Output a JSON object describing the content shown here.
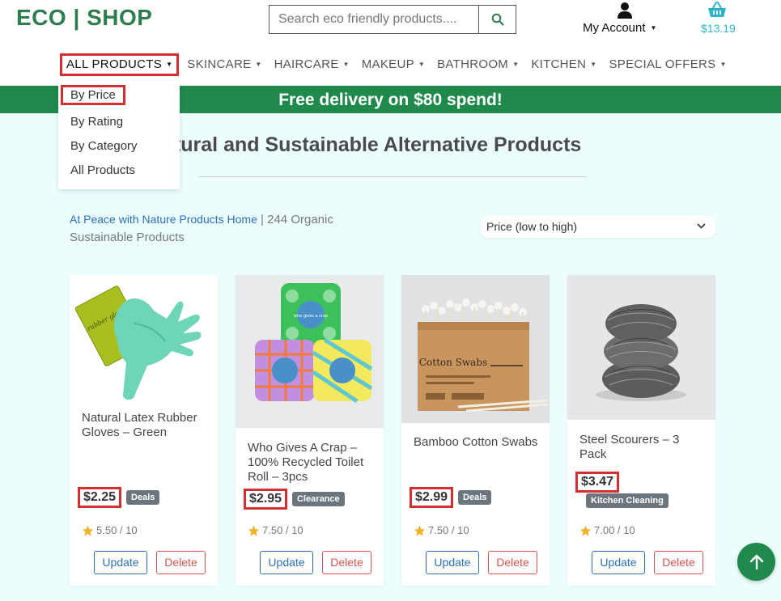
{
  "header": {
    "logo": "ECO | SHOP",
    "search_placeholder": "Search eco friendly products....",
    "account_label": "My Account",
    "cart_amount": "$13.19"
  },
  "nav": {
    "items": [
      {
        "label": "ALL PRODUCTS"
      },
      {
        "label": "SKINCARE"
      },
      {
        "label": "HAIRCARE"
      },
      {
        "label": "MAKEUP"
      },
      {
        "label": "BATHROOM"
      },
      {
        "label": "KITCHEN"
      },
      {
        "label": "SPECIAL OFFERS"
      }
    ],
    "dropdown": [
      "By Price",
      "By Rating",
      "By Category",
      "All Products"
    ]
  },
  "banner": "Free delivery on $80 spend!",
  "page_title": "Natural and Sustainable Alternative Products",
  "breadcrumb": {
    "link": "At Peace with Nature Products Home",
    "text": " | 244 Organic Sustainable Products"
  },
  "sort": {
    "selected": "Price (low to high)"
  },
  "products": [
    {
      "name": "Natural Latex Rubber Gloves – Green",
      "price": "$2.25",
      "badge": "Deals",
      "rating": "5.50 / 10",
      "update": "Update",
      "delete": "Delete"
    },
    {
      "name": "Who Gives A Crap – 100% Recycled Toilet Roll – 3pcs",
      "price": "$2.95",
      "badge": "Clearance",
      "rating": "7.50 / 10",
      "update": "Update",
      "delete": "Delete"
    },
    {
      "name": "Bamboo Cotton Swabs",
      "price": "$2.99",
      "badge": "Deals",
      "rating": "7.50 / 10",
      "update": "Update",
      "delete": "Delete"
    },
    {
      "name": "Steel Scourers – 3 Pack",
      "price": "$3.47",
      "badge": "Kitchen Cleaning",
      "rating": "7.00 / 10",
      "update": "Update",
      "delete": "Delete"
    }
  ],
  "images": {
    "gloves_pack_text": "rubber gloves",
    "roll_brand": "who gives a crap",
    "swabs_box_title": "Cotton Swabs"
  },
  "colors": {
    "brand_green": "#2e7d4f",
    "banner_green": "#1f8a4c",
    "highlight_red": "#d32f2f",
    "link_blue": "#2b6fb5",
    "cart_teal": "#2bb5c4",
    "page_background": "#ecfdfd"
  },
  "icons": {
    "search": "search-icon",
    "account": "user-icon",
    "cart": "basket-icon",
    "sort": "chevron-down-icon",
    "rating": "star-icon",
    "scroll": "arrow-up-icon"
  }
}
